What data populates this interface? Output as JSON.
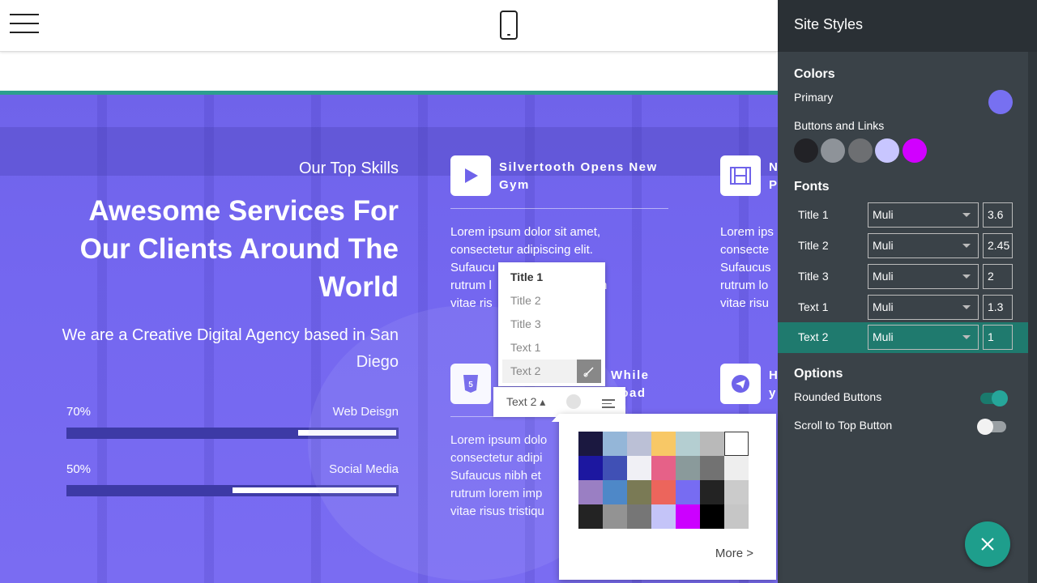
{
  "hero": {
    "subtitle": "Our Top Skills",
    "title": "Awesome Services For Our Clients Around The World",
    "tagline": "We are a Creative Digital Agency based in San Diego",
    "skills": [
      {
        "percent_label": "70%",
        "name": "Web Deisgn",
        "value": 0.7
      },
      {
        "percent_label": "50%",
        "name": "Social Media",
        "value": 0.5
      }
    ]
  },
  "cards": [
    {
      "icon": "play-icon",
      "title": "Silvertooth Opens New Gym",
      "text": "Lorem ipsum dolor sit amet,\nconsectetur adipiscing elit.\nSufaucu                 rsus id\nrutrum l                  Nunc sem\nvitae ris"
    },
    {
      "icon": "film-icon",
      "title": "N\nP",
      "text": "Lorem ips\nconsecte\nSufaucus\nrutrum lo\nvitae risu"
    },
    {
      "icon": "html5-icon",
      "title": "While\nRoad",
      "text": "Lorem ipsum dolo\nconsectetur adipi\nSufaucus nibh et\nrutrum lorem imp\nvitae risus tristiqu"
    },
    {
      "icon": "telegram-icon",
      "title": "H\ny",
      "text": ""
    }
  ],
  "font_menu": {
    "options": [
      "Title 1",
      "Title 2",
      "Title 3",
      "Text 1",
      "Text 2"
    ],
    "toolbar_label": "Text 2 ▴"
  },
  "color_picker": {
    "swatches": [
      "#1b1840",
      "#94b6d8",
      "#bbc0d6",
      "#f8c866",
      "#b4ced1",
      "#b9b9b9",
      "#ffffff",
      "#1c17a0",
      "#4050b5",
      "#f0f0f5",
      "#e66188",
      "#8a9a9b",
      "#727272",
      "#eeeeee",
      "#9a7fc3",
      "#4e88c8",
      "#7a7a55",
      "#ec655c",
      "#776cf2",
      "#232323",
      "#cbcbcb",
      "#232323",
      "#939393",
      "#767676",
      "#c4c4f8",
      "#cc00ff",
      "#000000",
      "#c6c6c6"
    ],
    "more_label": "More >"
  },
  "panel": {
    "title": "Site Styles",
    "colors_heading": "Colors",
    "primary_label": "Primary",
    "primary_color": "#7770f1",
    "buttons_label": "Buttons and Links",
    "button_colors": [
      "#222226",
      "#8e9399",
      "#6d6f72",
      "#c8c6ff",
      "#d100ff"
    ],
    "fonts_heading": "Fonts",
    "fonts": [
      {
        "label": "Title 1",
        "font": "Muli",
        "size": "3.6"
      },
      {
        "label": "Title 2",
        "font": "Muli",
        "size": "2.45"
      },
      {
        "label": "Title 3",
        "font": "Muli",
        "size": "2"
      },
      {
        "label": "Text 1",
        "font": "Muli",
        "size": "1.3"
      },
      {
        "label": "Text 2",
        "font": "Muli",
        "size": "1"
      }
    ],
    "options_heading": "Options",
    "rounded_label": "Rounded Buttons",
    "rounded_on": true,
    "scroll_label": "Scroll to Top Button",
    "scroll_on": false,
    "fab_icon": "close-icon"
  }
}
